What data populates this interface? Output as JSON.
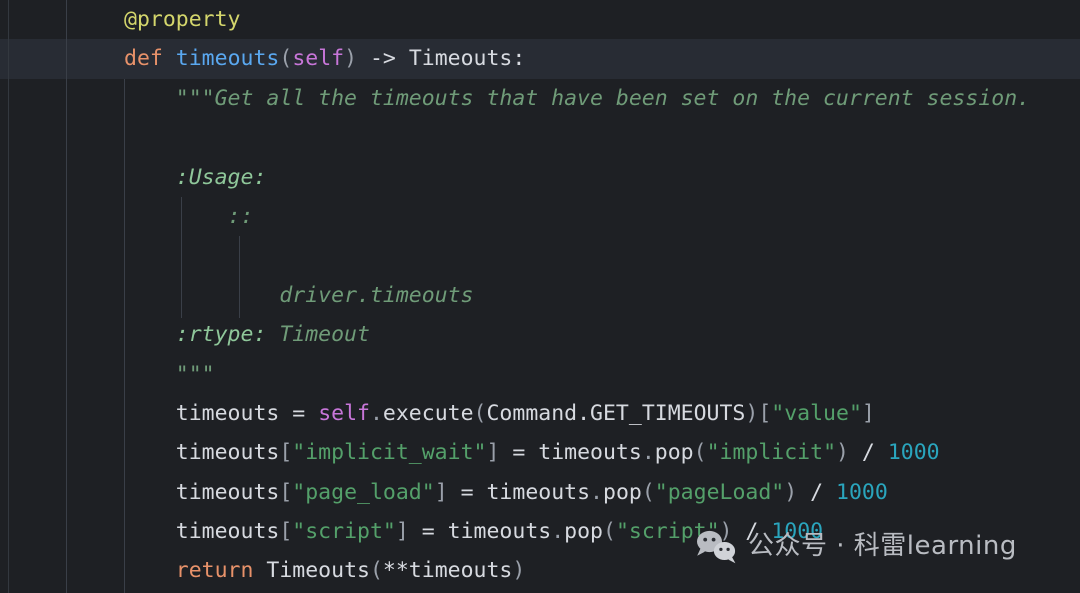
{
  "editor": {
    "language": "python",
    "theme": {
      "background": "#1e2024",
      "active_line_background": "#282c34",
      "foreground": "#d7dae0",
      "decorator": "#d4d66c",
      "keyword": "#e8926a",
      "function": "#5aa8f0",
      "self_param": "#c876d9",
      "punctuation": "#9aa0aa",
      "string": "#54a06a",
      "number": "#2aa5bd",
      "docstring": "#6f9b78",
      "docstring_field": "#8fc79a",
      "indent_guide": "#3a3f48"
    },
    "active_line_index": 1,
    "lines": [
      {
        "indent": 4,
        "active": false,
        "tokens": [
          {
            "text": "@property",
            "cls": "t-deco"
          }
        ]
      },
      {
        "indent": 4,
        "active": true,
        "tokens": [
          {
            "text": "def",
            "cls": "t-kw"
          },
          {
            "text": " ",
            "cls": "t-plain"
          },
          {
            "text": "timeouts",
            "cls": "t-fn"
          },
          {
            "text": "(",
            "cls": "t-punc"
          },
          {
            "text": "self",
            "cls": "t-self"
          },
          {
            "text": ")",
            "cls": "t-punc"
          },
          {
            "text": " -> ",
            "cls": "t-op"
          },
          {
            "text": "Timeouts:",
            "cls": "t-plain"
          }
        ]
      },
      {
        "indent": 8,
        "active": false,
        "tokens": [
          {
            "text": "\"\"\"Get all the timeouts that have been set on the current session.",
            "cls": "t-doc"
          }
        ]
      },
      {
        "indent": 8,
        "active": false,
        "tokens": []
      },
      {
        "indent": 8,
        "active": false,
        "tokens": [
          {
            "text": ":Usage:",
            "cls": "t-doc-b"
          }
        ]
      },
      {
        "indent": 12,
        "active": false,
        "tokens": [
          {
            "text": "::",
            "cls": "t-doc"
          }
        ]
      },
      {
        "indent": 8,
        "active": false,
        "tokens": []
      },
      {
        "indent": 16,
        "active": false,
        "tokens": [
          {
            "text": "driver.timeouts",
            "cls": "t-doc"
          }
        ]
      },
      {
        "indent": 8,
        "active": false,
        "tokens": [
          {
            "text": ":rtype:",
            "cls": "t-doc-b"
          },
          {
            "text": " Timeout",
            "cls": "t-doc"
          }
        ]
      },
      {
        "indent": 8,
        "active": false,
        "tokens": [
          {
            "text": "\"\"\"",
            "cls": "t-doc"
          }
        ]
      },
      {
        "indent": 8,
        "active": false,
        "tokens": [
          {
            "text": "timeouts",
            "cls": "t-plain"
          },
          {
            "text": " = ",
            "cls": "t-op"
          },
          {
            "text": "self",
            "cls": "t-self"
          },
          {
            "text": ".",
            "cls": "t-punc"
          },
          {
            "text": "execute",
            "cls": "t-plain"
          },
          {
            "text": "(",
            "cls": "t-punc"
          },
          {
            "text": "Command.GET_TIMEOUTS",
            "cls": "t-plain"
          },
          {
            "text": ")",
            "cls": "t-punc"
          },
          {
            "text": "[",
            "cls": "t-punc"
          },
          {
            "text": "\"value\"",
            "cls": "t-str"
          },
          {
            "text": "]",
            "cls": "t-punc"
          }
        ]
      },
      {
        "indent": 8,
        "active": false,
        "tokens": [
          {
            "text": "timeouts",
            "cls": "t-plain"
          },
          {
            "text": "[",
            "cls": "t-punc"
          },
          {
            "text": "\"implicit_wait\"",
            "cls": "t-str"
          },
          {
            "text": "]",
            "cls": "t-punc"
          },
          {
            "text": " = ",
            "cls": "t-op"
          },
          {
            "text": "timeouts",
            "cls": "t-plain"
          },
          {
            "text": ".",
            "cls": "t-punc"
          },
          {
            "text": "pop",
            "cls": "t-plain"
          },
          {
            "text": "(",
            "cls": "t-punc"
          },
          {
            "text": "\"implicit\"",
            "cls": "t-str"
          },
          {
            "text": ")",
            "cls": "t-punc"
          },
          {
            "text": " / ",
            "cls": "t-op"
          },
          {
            "text": "1000",
            "cls": "t-num"
          }
        ]
      },
      {
        "indent": 8,
        "active": false,
        "tokens": [
          {
            "text": "timeouts",
            "cls": "t-plain"
          },
          {
            "text": "[",
            "cls": "t-punc"
          },
          {
            "text": "\"page_load\"",
            "cls": "t-str"
          },
          {
            "text": "]",
            "cls": "t-punc"
          },
          {
            "text": " = ",
            "cls": "t-op"
          },
          {
            "text": "timeouts",
            "cls": "t-plain"
          },
          {
            "text": ".",
            "cls": "t-punc"
          },
          {
            "text": "pop",
            "cls": "t-plain"
          },
          {
            "text": "(",
            "cls": "t-punc"
          },
          {
            "text": "\"pageLoad\"",
            "cls": "t-str"
          },
          {
            "text": ")",
            "cls": "t-punc"
          },
          {
            "text": " / ",
            "cls": "t-op"
          },
          {
            "text": "1000",
            "cls": "t-num"
          }
        ]
      },
      {
        "indent": 8,
        "active": false,
        "tokens": [
          {
            "text": "timeouts",
            "cls": "t-plain"
          },
          {
            "text": "[",
            "cls": "t-punc"
          },
          {
            "text": "\"script\"",
            "cls": "t-str"
          },
          {
            "text": "]",
            "cls": "t-punc"
          },
          {
            "text": " = ",
            "cls": "t-op"
          },
          {
            "text": "timeouts",
            "cls": "t-plain"
          },
          {
            "text": ".",
            "cls": "t-punc"
          },
          {
            "text": "pop",
            "cls": "t-plain"
          },
          {
            "text": "(",
            "cls": "t-punc"
          },
          {
            "text": "\"script\"",
            "cls": "t-str"
          },
          {
            "text": ")",
            "cls": "t-punc"
          },
          {
            "text": " / ",
            "cls": "t-op"
          },
          {
            "text": "1000",
            "cls": "t-num"
          }
        ]
      },
      {
        "indent": 8,
        "active": false,
        "tokens": [
          {
            "text": "return",
            "cls": "t-kw"
          },
          {
            "text": " ",
            "cls": "t-plain"
          },
          {
            "text": "Timeouts",
            "cls": "t-plain"
          },
          {
            "text": "(",
            "cls": "t-punc"
          },
          {
            "text": "**timeouts",
            "cls": "t-plain"
          },
          {
            "text": ")",
            "cls": "t-punc"
          }
        ]
      }
    ],
    "indent_guide_columns": [
      0,
      4,
      8,
      12
    ]
  },
  "watermark": {
    "icon": "wechat-icon",
    "text": "公众号 · 科雷learning",
    "color": "#b9bcc2"
  }
}
